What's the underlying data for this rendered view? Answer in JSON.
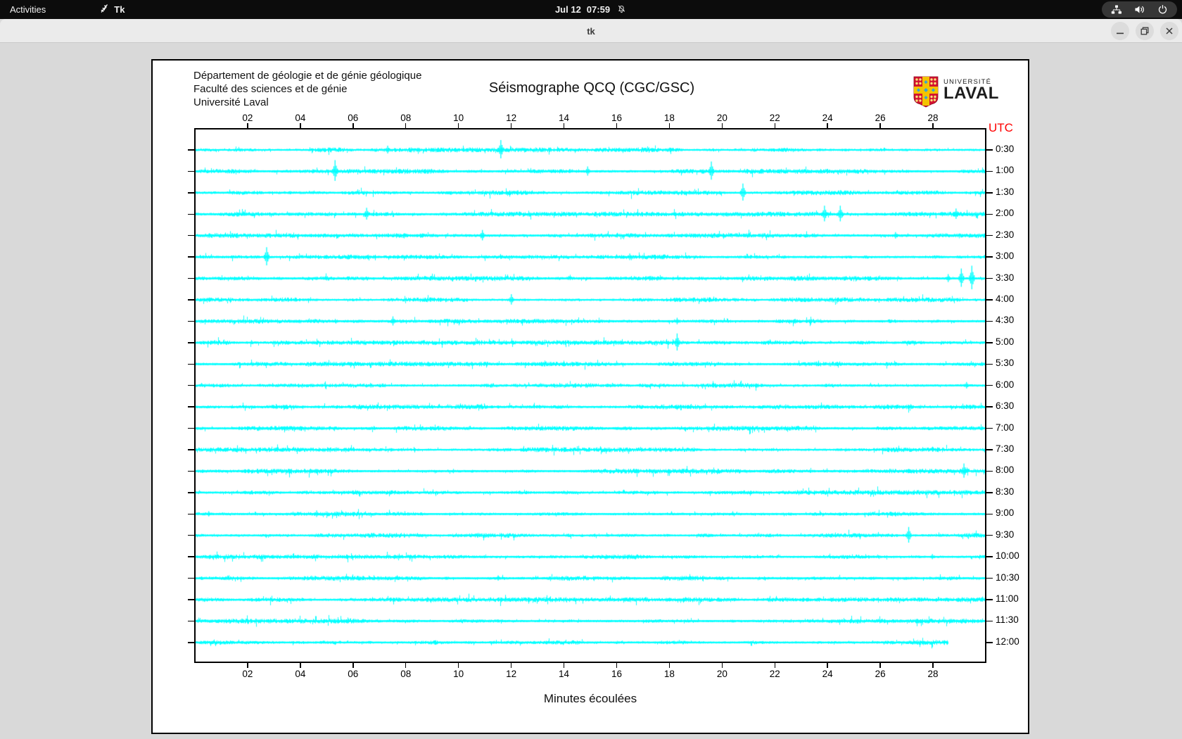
{
  "top_bar": {
    "activities_label": "Activities",
    "app_name": "Tk",
    "clock_date": "Jul 12",
    "clock_time": "07:59"
  },
  "window": {
    "title": "tk"
  },
  "seismograph": {
    "institution_lines": [
      "Département de géologie et de génie géologique",
      "Faculté des sciences et de génie",
      "Université Laval"
    ],
    "title": "Séismographe QCQ (CGC/GSC)",
    "logo": {
      "top": "UNIVERSITÉ",
      "bottom": "LAVAL",
      "shield_red": "#d41230",
      "shield_gold": "#f3c300",
      "shield_blue": "#33a3dc"
    },
    "utc_label": "UTC",
    "colors": {
      "trace": "#00ffff",
      "frame": "#000000",
      "utc_text": "#ff0000"
    },
    "x_axis": {
      "label": "Minutes écoulées",
      "range_minutes": [
        0,
        30
      ],
      "tick_minutes": [
        2,
        4,
        6,
        8,
        10,
        12,
        14,
        16,
        18,
        20,
        22,
        24,
        26,
        28
      ],
      "tick_labels": [
        "02",
        "04",
        "06",
        "08",
        "10",
        "12",
        "14",
        "16",
        "18",
        "20",
        "22",
        "24",
        "26",
        "28"
      ]
    },
    "rows": [
      {
        "utc": "0:30",
        "end_minute": 30,
        "spikes": [
          [
            7.3,
            6
          ],
          [
            11.6,
            14
          ]
        ]
      },
      {
        "utc": "1:00",
        "end_minute": 30,
        "spikes": [
          [
            5.3,
            16
          ],
          [
            14.9,
            7
          ],
          [
            19.6,
            14
          ]
        ]
      },
      {
        "utc": "1:30",
        "end_minute": 30,
        "spikes": [
          [
            20.8,
            13
          ]
        ]
      },
      {
        "utc": "2:00",
        "end_minute": 30,
        "spikes": [
          [
            6.5,
            9
          ],
          [
            23.9,
            12
          ],
          [
            24.5,
            12
          ],
          [
            28.9,
            8
          ]
        ]
      },
      {
        "utc": "2:30",
        "end_minute": 30,
        "spikes": [
          [
            10.9,
            8
          ],
          [
            26.6,
            5
          ]
        ]
      },
      {
        "utc": "3:00",
        "end_minute": 30,
        "spikes": [
          [
            2.7,
            14
          ],
          [
            16.5,
            5
          ]
        ]
      },
      {
        "utc": "3:30",
        "end_minute": 30,
        "spikes": [
          [
            28.6,
            6
          ],
          [
            29.1,
            14
          ],
          [
            29.5,
            18
          ]
        ]
      },
      {
        "utc": "4:00",
        "end_minute": 30,
        "spikes": [
          [
            12.0,
            8
          ]
        ]
      },
      {
        "utc": "4:30",
        "end_minute": 30,
        "spikes": [
          [
            7.5,
            7
          ],
          [
            18.3,
            5
          ]
        ]
      },
      {
        "utc": "5:00",
        "end_minute": 30,
        "spikes": [
          [
            18.3,
            13
          ]
        ]
      },
      {
        "utc": "5:30",
        "end_minute": 30,
        "spikes": []
      },
      {
        "utc": "6:00",
        "end_minute": 30,
        "spikes": [
          [
            29.3,
            5
          ]
        ]
      },
      {
        "utc": "6:30",
        "end_minute": 30,
        "spikes": []
      },
      {
        "utc": "7:00",
        "end_minute": 30,
        "spikes": []
      },
      {
        "utc": "7:30",
        "end_minute": 30,
        "spikes": []
      },
      {
        "utc": "8:00",
        "end_minute": 30,
        "spikes": [
          [
            29.2,
            11
          ]
        ]
      },
      {
        "utc": "8:30",
        "end_minute": 30,
        "spikes": []
      },
      {
        "utc": "9:00",
        "end_minute": 30,
        "spikes": [
          [
            0.5,
            4
          ],
          [
            4.6,
            5
          ]
        ]
      },
      {
        "utc": "9:30",
        "end_minute": 30,
        "spikes": [
          [
            27.1,
            12
          ]
        ]
      },
      {
        "utc": "10:00",
        "end_minute": 30,
        "spikes": [
          [
            28.0,
            4
          ]
        ]
      },
      {
        "utc": "10:30",
        "end_minute": 30,
        "spikes": [
          [
            11.5,
            4
          ]
        ]
      },
      {
        "utc": "11:00",
        "end_minute": 30,
        "spikes": []
      },
      {
        "utc": "11:30",
        "end_minute": 30,
        "spikes": []
      },
      {
        "utc": "12:00",
        "end_minute": 28.6,
        "spikes": []
      }
    ]
  }
}
